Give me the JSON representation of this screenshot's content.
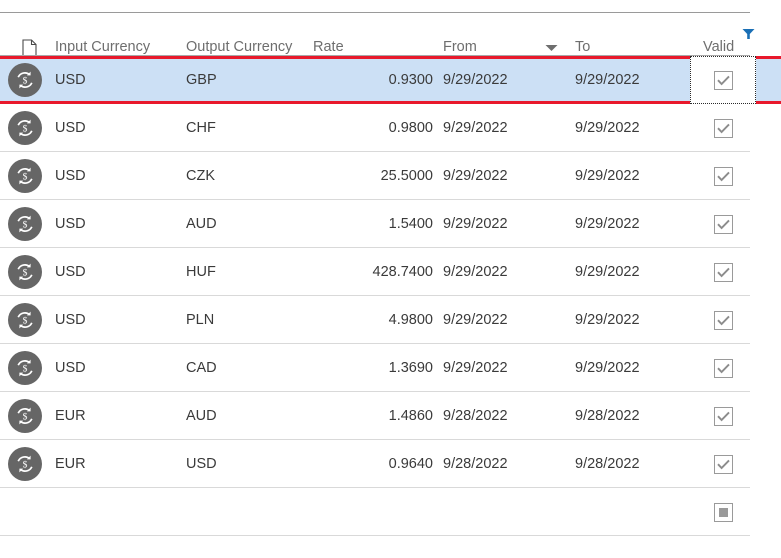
{
  "header": {
    "doc_icon": "document-icon",
    "columns": [
      {
        "key": "input",
        "label": "Input Currency"
      },
      {
        "key": "output",
        "label": "Output Currency"
      },
      {
        "key": "rate",
        "label": "Rate"
      },
      {
        "key": "from",
        "label": "From"
      },
      {
        "key": "to",
        "label": "To"
      },
      {
        "key": "valid",
        "label": "Valid"
      }
    ],
    "sort_icon": "sort-descending-icon",
    "sort_column": "From",
    "filter_icon": "filter-icon",
    "filter_column": "Valid"
  },
  "rows": [
    {
      "icon": "currency-exchange-icon",
      "input": "USD",
      "output": "GBP",
      "rate": "0.9300",
      "from": "9/29/2022",
      "to": "9/29/2022",
      "valid": "checked",
      "selected": true
    },
    {
      "icon": "currency-exchange-icon",
      "input": "USD",
      "output": "CHF",
      "rate": "0.9800",
      "from": "9/29/2022",
      "to": "9/29/2022",
      "valid": "checked",
      "selected": false
    },
    {
      "icon": "currency-exchange-icon",
      "input": "USD",
      "output": "CZK",
      "rate": "25.5000",
      "from": "9/29/2022",
      "to": "9/29/2022",
      "valid": "checked",
      "selected": false
    },
    {
      "icon": "currency-exchange-icon",
      "input": "USD",
      "output": "AUD",
      "rate": "1.5400",
      "from": "9/29/2022",
      "to": "9/29/2022",
      "valid": "checked",
      "selected": false
    },
    {
      "icon": "currency-exchange-icon",
      "input": "USD",
      "output": "HUF",
      "rate": "428.7400",
      "from": "9/29/2022",
      "to": "9/29/2022",
      "valid": "checked",
      "selected": false
    },
    {
      "icon": "currency-exchange-icon",
      "input": "USD",
      "output": "PLN",
      "rate": "4.9800",
      "from": "9/29/2022",
      "to": "9/29/2022",
      "valid": "checked",
      "selected": false
    },
    {
      "icon": "currency-exchange-icon",
      "input": "USD",
      "output": "CAD",
      "rate": "1.3690",
      "from": "9/29/2022",
      "to": "9/29/2022",
      "valid": "checked",
      "selected": false
    },
    {
      "icon": "currency-exchange-icon",
      "input": "EUR",
      "output": "AUD",
      "rate": "1.4860",
      "from": "9/28/2022",
      "to": "9/28/2022",
      "valid": "checked",
      "selected": false
    },
    {
      "icon": "currency-exchange-icon",
      "input": "EUR",
      "output": "USD",
      "rate": "0.9640",
      "from": "9/28/2022",
      "to": "9/28/2022",
      "valid": "checked",
      "selected": false
    },
    {
      "icon": "",
      "input": "",
      "output": "",
      "rate": "",
      "from": "",
      "to": "",
      "valid": "indeterminate",
      "selected": false
    }
  ],
  "colors": {
    "selection_fill": "#cce0f5",
    "selection_border": "#e8192c",
    "row_separator": "#d9d9d9",
    "header_text": "#6e6e6e",
    "cell_text": "#3a3a3a",
    "fx_icon_bg": "#666666",
    "filter_icon": "#1a6fb5",
    "checkbox_border": "#9a9a9a"
  }
}
